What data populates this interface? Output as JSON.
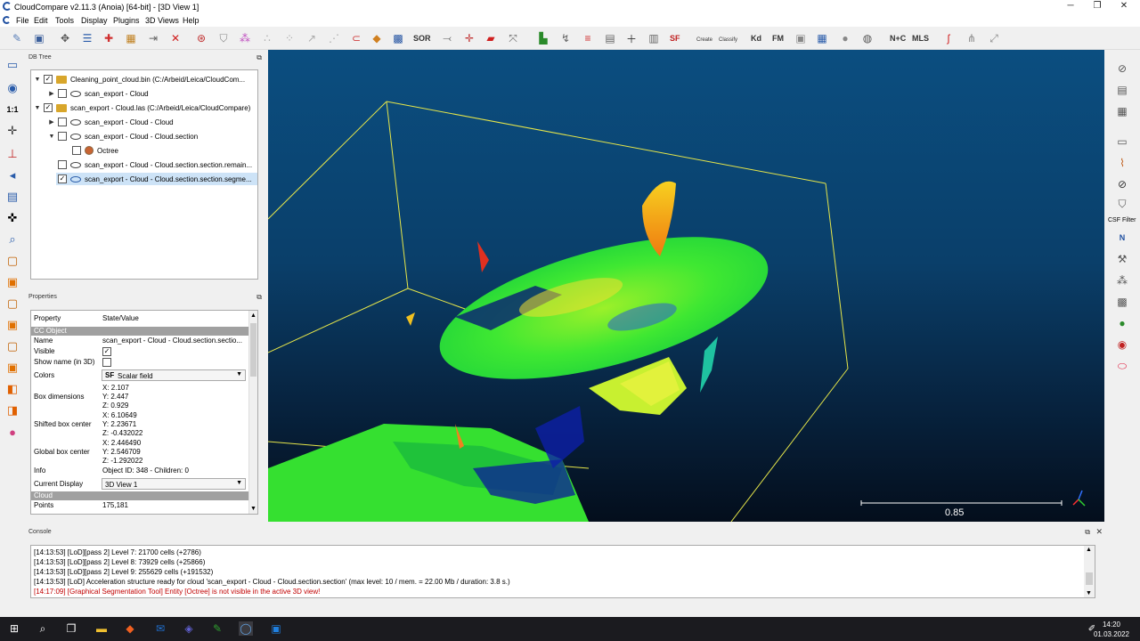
{
  "window": {
    "title": "CloudCompare v2.11.3 (Anoia) [64-bit] - [3D View 1]",
    "minimize": "─",
    "restore": "❐",
    "close": "✕"
  },
  "menu": [
    "File",
    "Edit",
    "Tools",
    "Display",
    "Plugins",
    "3D Views",
    "Help"
  ],
  "toolbar": {
    "sor_label": "SOR",
    "sf_label": "SF",
    "kd_label": "Kd",
    "fm_label": "FM",
    "nc_label": "N+C",
    "mls_label": "MLS",
    "canupo_create": "Create",
    "canupo_classify": "Classify"
  },
  "left_toolbar": {
    "one_to_one": "1:1"
  },
  "right_toolbar": {
    "csf_filter": "CSF Filter",
    "north": "N"
  },
  "db_tree": {
    "header": "DB Tree",
    "float_icon": "⧉",
    "items": [
      {
        "label": "Cleaning_point_cloud.bin (C:/Arbeid/Leica/CloudCom...",
        "checked": true,
        "expanded": true,
        "type": "folder"
      },
      {
        "label": "scan_export - Cloud",
        "checked": false,
        "expanded": false,
        "type": "cloud"
      },
      {
        "label": "scan_export - Cloud.las (C:/Arbeid/Leica/CloudCompare)",
        "checked": true,
        "expanded": true,
        "type": "folder"
      },
      {
        "label": "scan_export - Cloud - Cloud",
        "checked": false,
        "expanded": false,
        "type": "cloud"
      },
      {
        "label": "scan_export - Cloud - Cloud.section",
        "checked": false,
        "expanded": true,
        "type": "cloud"
      },
      {
        "label": "Octree",
        "checked": false,
        "expanded": false,
        "type": "octree"
      },
      {
        "label": "scan_export - Cloud - Cloud.section.section.remain...",
        "checked": false,
        "expanded": false,
        "type": "cloud"
      },
      {
        "label": "scan_export - Cloud - Cloud.section.section.segme...",
        "checked": true,
        "expanded": false,
        "type": "cloud"
      }
    ]
  },
  "properties": {
    "header": "Properties",
    "float_icon": "⧉",
    "col_property": "Property",
    "col_value": "State/Value",
    "group_cc": "CC Object",
    "name_key": "Name",
    "name_val": "scan_export - Cloud - Cloud.section.sectio...",
    "visible_key": "Visible",
    "showname_key": "Show name (in 3D)",
    "colors_key": "Colors",
    "colors_val": "Scalar field",
    "boxdim_key": "Box dimensions",
    "boxdim_x": "X: 2.107",
    "boxdim_y": "Y: 2.447",
    "boxdim_z": "Z: 0.929",
    "shifted_key": "Shifted box center",
    "shifted_x": "X: 6.10649",
    "shifted_y": "Y: 2.23671",
    "shifted_z": "Z: -0.432022",
    "global_key": "Global box center",
    "global_x": "X: 2.446490",
    "global_y": "Y: 2.546709",
    "global_z": "Z: -1.292022",
    "info_key": "Info",
    "info_val": "Object ID: 348 - Children: 0",
    "display_key": "Current Display",
    "display_val": "3D View 1",
    "group_cloud": "Cloud",
    "points_key": "Points",
    "points_val": "175,181"
  },
  "view3d": {
    "scale_value": "0.85"
  },
  "console": {
    "header": "Console",
    "lines": [
      {
        "text": "[14:13:53] [LoD][pass 2] Level 7: 21700 cells (+2786)",
        "color": "#000000"
      },
      {
        "text": "[14:13:53] [LoD][pass 2] Level 8: 73929 cells (+25866)",
        "color": "#000000"
      },
      {
        "text": "[14:13:53] [LoD][pass 2] Level 9: 255629 cells (+191532)",
        "color": "#000000"
      },
      {
        "text": "[14:13:53] [LoD] Acceleration structure ready for cloud 'scan_export - Cloud - Cloud.section.section' (max level: 10 / mem. = 22.00 Mb / duration: 3.8 s.)",
        "color": "#000000"
      },
      {
        "text": "[14:17:09] [Graphical Segmentation Tool] Entity [Octree] is not visible in the active 3D view!",
        "color": "#c00000"
      }
    ]
  },
  "taskbar": {
    "time": "14:20",
    "date": "01.03.2022"
  }
}
